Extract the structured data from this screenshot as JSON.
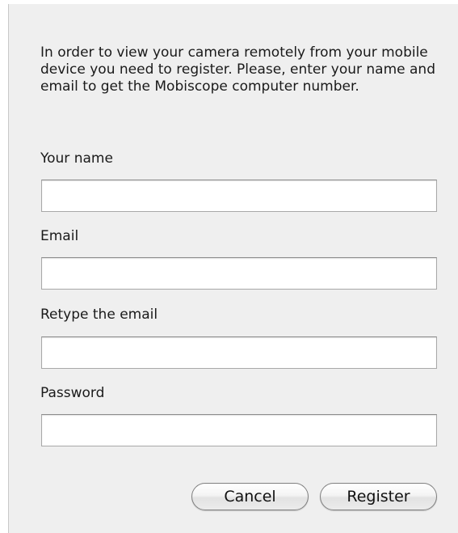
{
  "dialog": {
    "intro_text": "In order to view your camera remotely from your mobile device you need to register. Please, enter your name and email to get the Mobiscope computer number.",
    "fields": [
      {
        "label": "Your name",
        "value": "",
        "placeholder": ""
      },
      {
        "label": "Email",
        "value": "",
        "placeholder": ""
      },
      {
        "label": "Retype the email",
        "value": "",
        "placeholder": ""
      },
      {
        "label": "Password",
        "value": "",
        "placeholder": ""
      }
    ],
    "buttons": {
      "cancel_label": "Cancel",
      "register_label": "Register"
    }
  }
}
